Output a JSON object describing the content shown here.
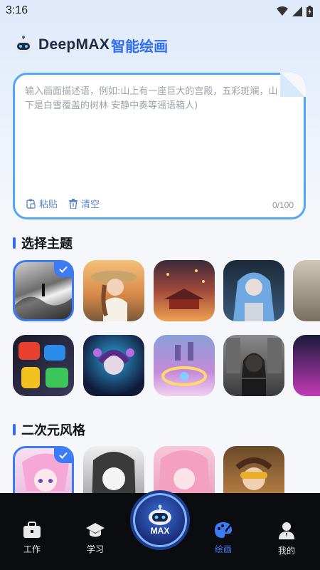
{
  "status_bar": {
    "time": "3:16"
  },
  "brand": {
    "name_en": "DeepMAX",
    "name_cn": "智能绘画"
  },
  "prompt": {
    "placeholder": "输入画面描述语，例如:山上有一座巨大的宫殿，五彩斑斓，山下是白雪覆盖的树林 安静中奏等谣语箱人)",
    "paste_label": "粘贴",
    "clear_label": "清空",
    "counter": "0/100"
  },
  "sections": [
    {
      "title": "选择主题"
    },
    {
      "title": "二次元风格"
    }
  ],
  "bottom_nav": {
    "items": [
      {
        "label": "工作",
        "icon": "briefcase-icon"
      },
      {
        "label": "学习",
        "icon": "graduation-cap-icon"
      },
      {
        "label": "绘画",
        "icon": "palette-icon"
      },
      {
        "label": "我的",
        "icon": "user-icon"
      }
    ],
    "center_label": "MAX",
    "active": "绘画"
  },
  "colors": {
    "accent": "#2f6df6",
    "border": "#52a7f5",
    "nav_bg": "#0b0c0f"
  }
}
